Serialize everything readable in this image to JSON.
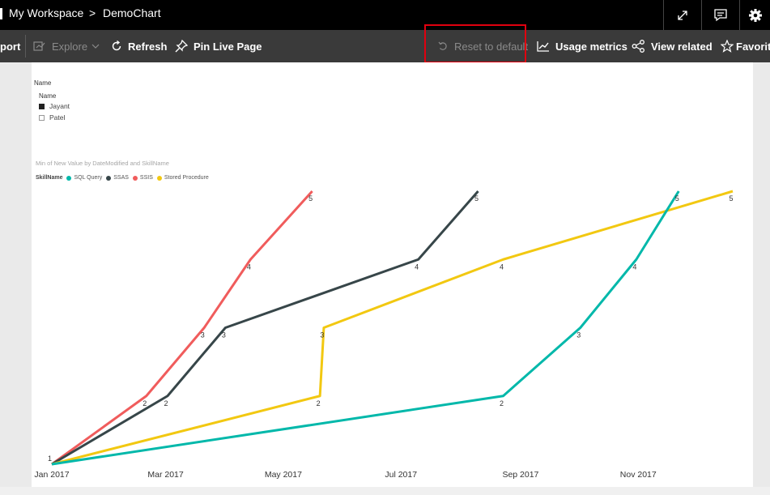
{
  "breadcrumb": {
    "workspace": "My Workspace",
    "separator": ">",
    "report": "DemoChart"
  },
  "toolbar": {
    "export_label": "port",
    "explore_label": "Explore",
    "refresh_label": "Refresh",
    "pin_label": "Pin Live Page",
    "reset_label": "Reset to default",
    "usage_label": "Usage metrics",
    "related_label": "View related",
    "favorite_label": "Favorite"
  },
  "icons": {
    "expand": "expand-icon",
    "comment": "comment-icon",
    "settings": "gear-icon"
  },
  "slicer": {
    "title": "Name",
    "header": "Name",
    "options": [
      {
        "label": "Jayant",
        "checked": true
      },
      {
        "label": "Patel",
        "checked": false
      }
    ]
  },
  "chart_data": {
    "type": "line",
    "title": "Min of New Value by DateModified and SkillName",
    "legend_title": "SkillName",
    "legend_position": "top-left",
    "xlabel": "",
    "ylabel": "",
    "x_ticks": [
      "Jan 2017",
      "Mar 2017",
      "May 2017",
      "Jul 2017",
      "Sep 2017",
      "Nov 2017"
    ],
    "xlim": [
      "2017-01-01",
      "2017-12-20"
    ],
    "ylim": [
      1,
      5
    ],
    "grid": false,
    "series": [
      {
        "name": "SSIS",
        "color": "#f05c5c",
        "points": [
          {
            "x": "2017-01-01",
            "y": 1
          },
          {
            "x": "2017-02-19",
            "y": 2
          },
          {
            "x": "2017-03-21",
            "y": 3
          },
          {
            "x": "2017-04-14",
            "y": 4
          },
          {
            "x": "2017-05-16",
            "y": 5
          }
        ]
      },
      {
        "name": "SSAS",
        "color": "#374649",
        "points": [
          {
            "x": "2017-01-01",
            "y": 1
          },
          {
            "x": "2017-03-02",
            "y": 2
          },
          {
            "x": "2017-04-01",
            "y": 3
          },
          {
            "x": "2017-07-10",
            "y": 4
          },
          {
            "x": "2017-08-10",
            "y": 5
          }
        ]
      },
      {
        "name": "Stored Procedure",
        "color": "#f2c811",
        "points": [
          {
            "x": "2017-01-01",
            "y": 1
          },
          {
            "x": "2017-05-20",
            "y": 2
          },
          {
            "x": "2017-05-22",
            "y": 3
          },
          {
            "x": "2017-08-23",
            "y": 4
          },
          {
            "x": "2017-12-20",
            "y": 5
          }
        ]
      },
      {
        "name": "SQL Query",
        "color": "#01b8aa",
        "points": [
          {
            "x": "2017-01-01",
            "y": 1
          },
          {
            "x": "2017-08-23",
            "y": 2
          },
          {
            "x": "2017-10-02",
            "y": 3
          },
          {
            "x": "2017-10-31",
            "y": 4
          },
          {
            "x": "2017-11-22",
            "y": 5
          }
        ]
      }
    ],
    "legend_order": [
      "SQL Query",
      "SSAS",
      "SSIS",
      "Stored Procedure"
    ]
  }
}
